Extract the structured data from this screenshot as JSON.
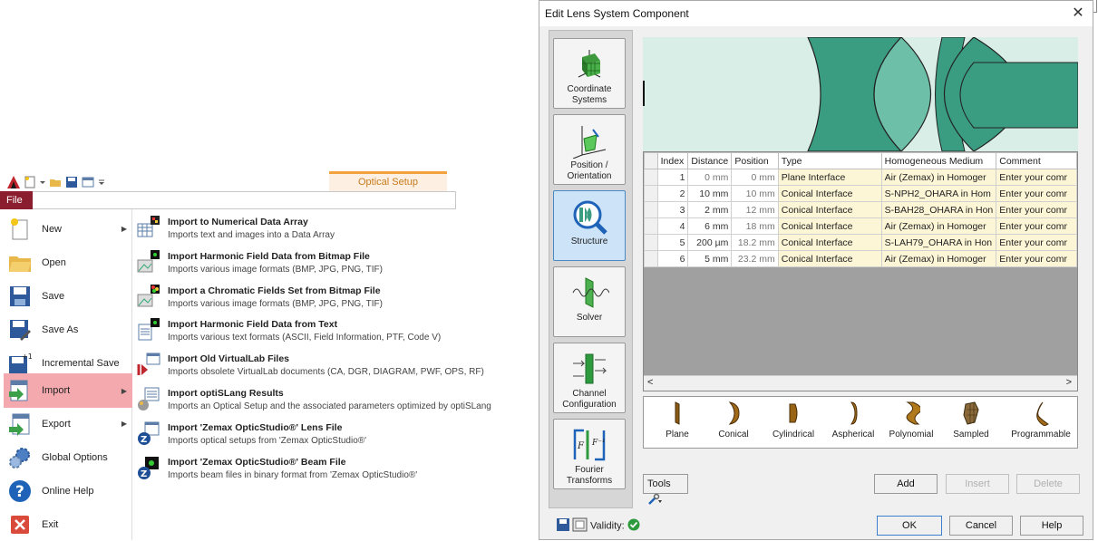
{
  "ribbon": {
    "context_tab": "Optical Setup",
    "file_tab": "File"
  },
  "file_menu": {
    "items": [
      {
        "label": "New",
        "arrow": true
      },
      {
        "label": "Open",
        "arrow": false
      },
      {
        "label": "Save",
        "arrow": false
      },
      {
        "label": "Save As",
        "arrow": false
      },
      {
        "label": "Incremental Save",
        "arrow": false
      },
      {
        "label": "Import",
        "arrow": true,
        "selected": true
      },
      {
        "label": "Export",
        "arrow": true
      },
      {
        "label": "Global Options",
        "arrow": false
      },
      {
        "label": "Online Help",
        "arrow": false
      },
      {
        "label": "Exit",
        "arrow": false
      }
    ],
    "arrow_glyph": "▶"
  },
  "import_submenu": [
    {
      "title": "Import to Numerical Data Array",
      "desc": "Imports text and images into a Data Array"
    },
    {
      "title": "Import Harmonic Field Data from Bitmap File",
      "desc": "Imports various image formats (BMP, JPG, PNG, TIF)"
    },
    {
      "title": "Import a Chromatic Fields Set from Bitmap File",
      "desc": "Imports various image formats (BMP, JPG, PNG, TIF)"
    },
    {
      "title": "Import Harmonic Field Data from Text",
      "desc": "Imports various text formats (ASCII, Field Information, PTF, Code V)"
    },
    {
      "title": "Import Old VirtualLab Files",
      "desc": "Imports obsolete VirtualLab documents (CA, DGR, DIAGRAM, PWF, OPS, RF)"
    },
    {
      "title": "Import optiSLang Results",
      "desc": "Imports an Optical Setup and the associated parameters optimized by optiSLang"
    },
    {
      "title": "Import 'Zemax OpticStudio®' Lens File",
      "desc": "Imports optical setups from 'Zemax OpticStudio®'"
    },
    {
      "title": "Import 'Zemax OpticStudio®' Beam File",
      "desc": "Imports beam files in binary format from 'Zemax OpticStudio®'"
    }
  ],
  "dialog": {
    "title": "Edit Lens System Component",
    "close_glyph": "✕",
    "sidebar": [
      {
        "label": "Coordinate Systems"
      },
      {
        "label": "Position / Orientation"
      },
      {
        "label": "Structure",
        "selected": true
      },
      {
        "label": "Solver"
      },
      {
        "label": "Channel Configuration"
      },
      {
        "label": "Fourier Transforms"
      }
    ],
    "table": {
      "columns": [
        "Index",
        "Distance",
        "Position",
        "Type",
        "Homogeneous Medium",
        "Comment"
      ],
      "rows": [
        {
          "index": "1",
          "distance": "0 mm",
          "position": "0 mm",
          "type": "Plane Interface",
          "medium": "Air (Zemax) in Homoger",
          "comment": "Enter your comr"
        },
        {
          "index": "2",
          "distance": "10 mm",
          "position": "10 mm",
          "type": "Conical Interface",
          "medium": "S-NPH2_OHARA in Hom",
          "comment": "Enter your comr"
        },
        {
          "index": "3",
          "distance": "2 mm",
          "position": "12 mm",
          "type": "Conical Interface",
          "medium": "S-BAH28_OHARA in Hon",
          "comment": "Enter your comr"
        },
        {
          "index": "4",
          "distance": "6 mm",
          "position": "18 mm",
          "type": "Conical Interface",
          "medium": "Air (Zemax) in Homoger",
          "comment": "Enter your comr"
        },
        {
          "index": "5",
          "distance": "200 µm",
          "position": "18.2 mm",
          "type": "Conical Interface",
          "medium": "S-LAH79_OHARA in Hon",
          "comment": "Enter your comr"
        },
        {
          "index": "6",
          "distance": "5 mm",
          "position": "23.2 mm",
          "type": "Conical Interface",
          "medium": "Air (Zemax) in Homoger",
          "comment": "Enter your comr"
        }
      ]
    },
    "scroll": {
      "left": "<",
      "right": ">"
    },
    "elements": [
      "Plane",
      "Conical",
      "Cylindrical",
      "Aspherical",
      "Polynomial",
      "Sampled",
      "Programmable"
    ],
    "tools_label": "Tools",
    "buttons": {
      "add": "Add",
      "insert": "Insert",
      "delete": "Delete",
      "ok": "OK",
      "cancel": "Cancel",
      "help": "Help"
    },
    "validity_label": "Validity:"
  },
  "colors": {
    "accent": "#8b1e2e",
    "selection": "#f3a9ad",
    "lens_fill": "#3a9c80",
    "preview_bg": "#d8eee7"
  }
}
